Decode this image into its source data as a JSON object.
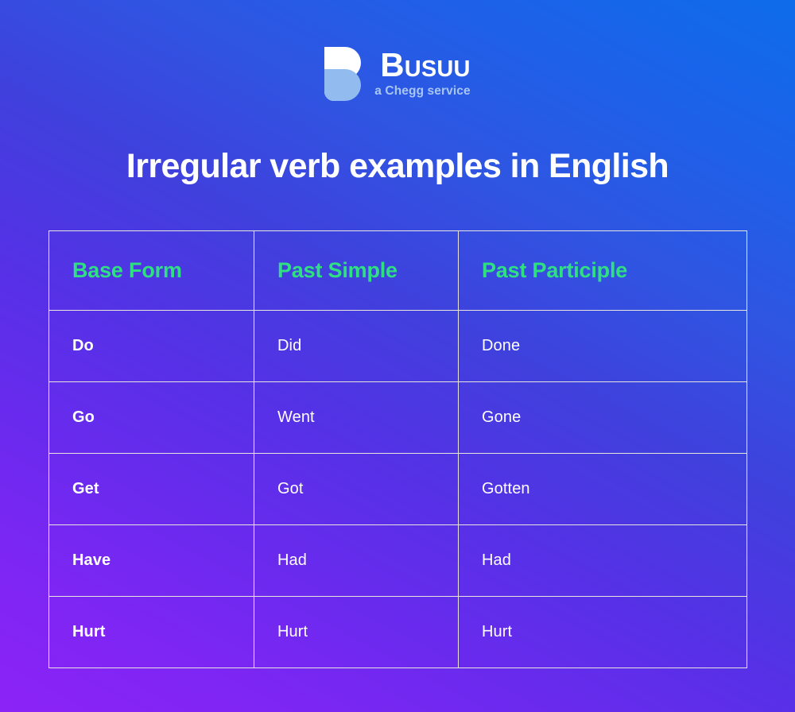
{
  "brand": {
    "logo_icon": "busuu-b-logo",
    "name": "Busuu",
    "tagline": "a Chegg service"
  },
  "header": {
    "title": "Irregular verb examples in English"
  },
  "colors": {
    "header_text": "#2FE082",
    "body_text": "#FFFFFF",
    "tagline": "#A9C6F2",
    "border": "#E8E4E0",
    "bg_gradient_from": "#0E6CEB",
    "bg_gradient_to": "#8C23F6"
  },
  "table": {
    "columns": [
      "Base Form",
      "Past Simple",
      "Past Participle"
    ],
    "rows": [
      {
        "base": "Do",
        "past_simple": "Did",
        "past_participle": "Done"
      },
      {
        "base": "Go",
        "past_simple": "Went",
        "past_participle": "Gone"
      },
      {
        "base": "Get",
        "past_simple": "Got",
        "past_participle": "Gotten"
      },
      {
        "base": "Have",
        "past_simple": "Had",
        "past_participle": "Had"
      },
      {
        "base": "Hurt",
        "past_simple": "Hurt",
        "past_participle": "Hurt"
      }
    ]
  }
}
